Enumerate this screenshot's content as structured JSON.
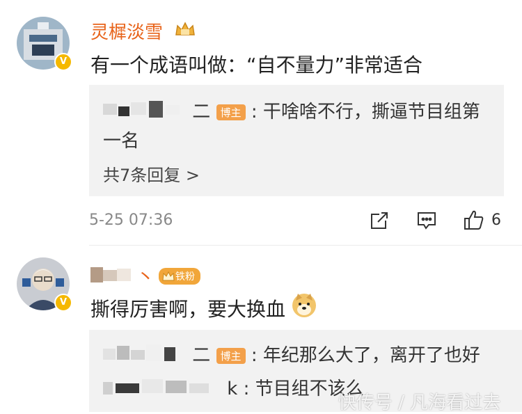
{
  "comment1": {
    "username": "灵樨淡雪",
    "text": "有一个成语叫做：“自不量力”非常适合",
    "reply": {
      "author_suffix": "二",
      "badge": "博主",
      "text_line1": ": 干啥啥不行，撕逼节目组第",
      "text_line2": "一名"
    },
    "more_replies": "共7条回复 >",
    "timestamp": "5-25 07:36",
    "like_count": "6"
  },
  "comment2": {
    "username_suffix": "丶",
    "fan_badge": "铁粉",
    "text": "撕得厉害啊，要大换血",
    "reply1": {
      "author_suffix": "二",
      "badge": "博主",
      "text": ": 年纪那么大了，离开了也好"
    },
    "reply2": {
      "author_suffix": "k",
      "text": ": 节目组不该么"
    }
  },
  "watermark": "快传号 / 凡海看过去",
  "colors": {
    "username": "#e8641b",
    "badge": "#f3a04a",
    "verified": "#f5b800"
  },
  "icons": [
    "share-icon",
    "comment-icon",
    "like-icon",
    "crown-icon",
    "doge-emoji-icon",
    "verified-icon"
  ]
}
